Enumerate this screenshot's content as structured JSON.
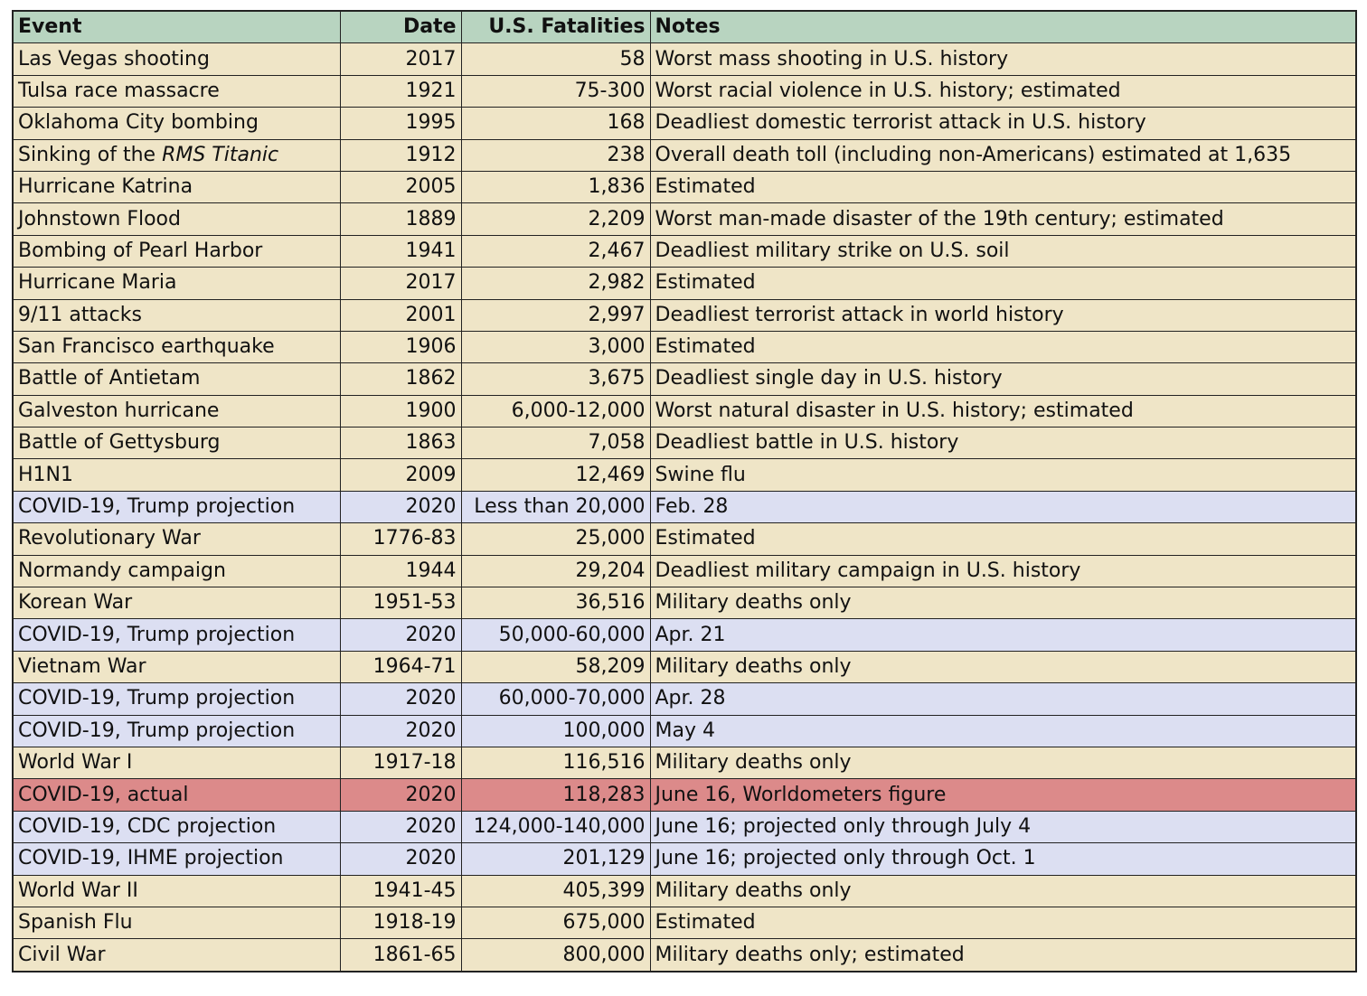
{
  "colors": {
    "header": "#b8d4c0",
    "event": "#efe5c7",
    "projection": "#dcdff2",
    "actual": "#dc8a8a",
    "border": "#222222"
  },
  "headers": [
    "Event",
    "Date",
    "U.S. Fatalities",
    "Notes"
  ],
  "rows": [
    {
      "event": "Las Vegas shooting",
      "date": "2017",
      "fatalities": "58",
      "notes": "Worst mass shooting in U.S. history",
      "type": "event"
    },
    {
      "event": "Tulsa race massacre",
      "date": "1921",
      "fatalities": "75-300",
      "notes": "Worst racial violence in U.S. history; estimated",
      "type": "event"
    },
    {
      "event": "Oklahoma City bombing",
      "date": "1995",
      "fatalities": "168",
      "notes": "Deadliest domestic terrorist attack in U.S. history",
      "type": "event"
    },
    {
      "event": "Sinking of the ",
      "event_italic": "RMS Titanic",
      "date": "1912",
      "fatalities": "238",
      "notes": "Overall death toll (including non-Americans) estimated at 1,635",
      "type": "event"
    },
    {
      "event": "Hurricane Katrina",
      "date": "2005",
      "fatalities": "1,836",
      "notes": "Estimated",
      "type": "event"
    },
    {
      "event": "Johnstown Flood",
      "date": "1889",
      "fatalities": "2,209",
      "notes": "Worst man-made disaster of the 19th century; estimated",
      "type": "event"
    },
    {
      "event": "Bombing of Pearl Harbor",
      "date": "1941",
      "fatalities": "2,467",
      "notes": "Deadliest military strike on U.S. soil",
      "type": "event"
    },
    {
      "event": "Hurricane Maria",
      "date": "2017",
      "fatalities": "2,982",
      "notes": "Estimated",
      "type": "event"
    },
    {
      "event": "9/11 attacks",
      "date": "2001",
      "fatalities": "2,997",
      "notes": "Deadliest terrorist attack in world history",
      "type": "event"
    },
    {
      "event": "San Francisco earthquake",
      "date": "1906",
      "fatalities": "3,000",
      "notes": "Estimated",
      "type": "event"
    },
    {
      "event": "Battle of Antietam",
      "date": "1862",
      "fatalities": "3,675",
      "notes": "Deadliest single day in U.S. history",
      "type": "event"
    },
    {
      "event": "Galveston hurricane",
      "date": "1900",
      "fatalities": "6,000-12,000",
      "notes": "Worst natural disaster in U.S. history; estimated",
      "type": "event"
    },
    {
      "event": "Battle of Gettysburg",
      "date": "1863",
      "fatalities": "7,058",
      "notes": "Deadliest battle in U.S. history",
      "type": "event"
    },
    {
      "event": "H1N1",
      "date": "2009",
      "fatalities": "12,469",
      "notes": "Swine flu",
      "type": "event"
    },
    {
      "event": "COVID-19, Trump projection",
      "date": "2020",
      "fatalities": "Less than 20,000",
      "notes": "Feb. 28",
      "type": "projection"
    },
    {
      "event": "Revolutionary War",
      "date": "1776-83",
      "fatalities": "25,000",
      "notes": "Estimated",
      "type": "event"
    },
    {
      "event": "Normandy campaign",
      "date": "1944",
      "fatalities": "29,204",
      "notes": "Deadliest military campaign in U.S. history",
      "type": "event"
    },
    {
      "event": "Korean War",
      "date": "1951-53",
      "fatalities": "36,516",
      "notes": "Military deaths only",
      "type": "event"
    },
    {
      "event": "COVID-19, Trump projection",
      "date": "2020",
      "fatalities": "50,000-60,000",
      "notes": "Apr. 21",
      "type": "projection"
    },
    {
      "event": "Vietnam War",
      "date": "1964-71",
      "fatalities": "58,209",
      "notes": "Military deaths only",
      "type": "event"
    },
    {
      "event": "COVID-19, Trump projection",
      "date": "2020",
      "fatalities": "60,000-70,000",
      "notes": "Apr. 28",
      "type": "projection"
    },
    {
      "event": "COVID-19, Trump projection",
      "date": "2020",
      "fatalities": "100,000",
      "notes": "May 4",
      "type": "projection"
    },
    {
      "event": "World War I",
      "date": "1917-18",
      "fatalities": "116,516",
      "notes": "Military deaths only",
      "type": "event"
    },
    {
      "event": "COVID-19, actual",
      "date": "2020",
      "fatalities": "118,283",
      "notes": "June 16, Worldometers figure",
      "type": "actual"
    },
    {
      "event": "COVID-19, CDC projection",
      "date": "2020",
      "fatalities": "124,000-140,000",
      "notes": "June 16; projected only through July 4",
      "type": "projection"
    },
    {
      "event": "COVID-19, IHME projection",
      "date": "2020",
      "fatalities": "201,129",
      "notes": "June 16; projected only through Oct. 1",
      "type": "projection"
    },
    {
      "event": "World War II",
      "date": "1941-45",
      "fatalities": "405,399",
      "notes": "Military deaths only",
      "type": "event"
    },
    {
      "event": "Spanish Flu",
      "date": "1918-19",
      "fatalities": "675,000",
      "notes": "Estimated",
      "type": "event"
    },
    {
      "event": "Civil War",
      "date": "1861-65",
      "fatalities": "800,000",
      "notes": "Military deaths only; estimated",
      "type": "event"
    }
  ]
}
